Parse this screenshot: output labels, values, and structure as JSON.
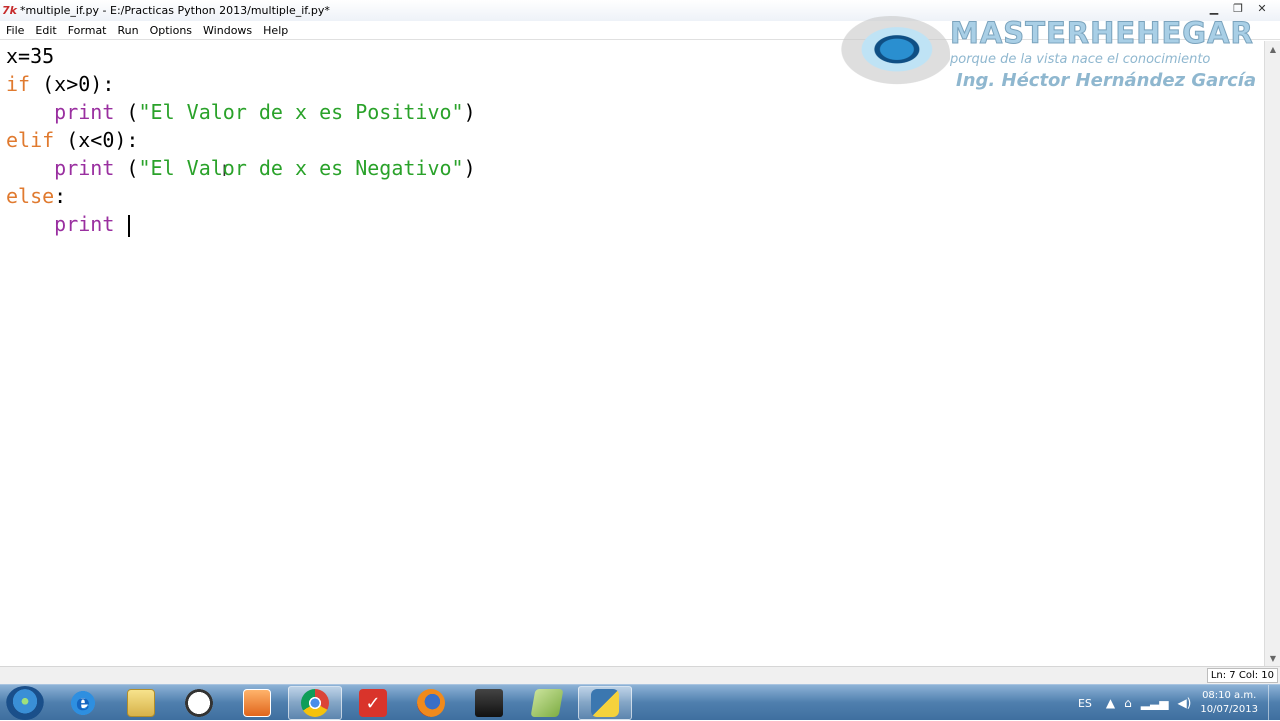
{
  "window": {
    "title": "*multiple_if.py - E:/Practicas Python 2013/multiple_if.py*",
    "controls": {
      "minimize": "▁",
      "maximize": "❐",
      "close": "✕"
    }
  },
  "menu": {
    "items": [
      "File",
      "Edit",
      "Format",
      "Run",
      "Options",
      "Windows",
      "Help"
    ]
  },
  "editor": {
    "lines": [
      {
        "parts": [
          {
            "text": "x=35",
            "kind": "plain"
          }
        ]
      },
      {
        "parts": [
          {
            "text": "if",
            "kind": "kw"
          },
          {
            "text": " (x>0):",
            "kind": "plain"
          }
        ]
      },
      {
        "parts": [
          {
            "text": "    ",
            "kind": "plain"
          },
          {
            "text": "print",
            "kind": "bi"
          },
          {
            "text": " (",
            "kind": "plain"
          },
          {
            "text": "\"El Valor de x es Positivo\"",
            "kind": "str"
          },
          {
            "text": ")",
            "kind": "plain"
          }
        ]
      },
      {
        "parts": [
          {
            "text": "elif",
            "kind": "kw"
          },
          {
            "text": " (x<0):",
            "kind": "plain"
          }
        ]
      },
      {
        "parts": [
          {
            "text": "    ",
            "kind": "plain"
          },
          {
            "text": "print",
            "kind": "bi"
          },
          {
            "text": " (",
            "kind": "plain"
          },
          {
            "text": "\"El Valor de x es Negativo\"",
            "kind": "str"
          },
          {
            "text": ")",
            "kind": "plain"
          }
        ]
      },
      {
        "parts": [
          {
            "text": "else",
            "kind": "kw"
          },
          {
            "text": ":",
            "kind": "plain"
          }
        ]
      },
      {
        "parts": [
          {
            "text": "    ",
            "kind": "plain"
          },
          {
            "text": "print",
            "kind": "bi"
          },
          {
            "text": " ",
            "kind": "plain"
          }
        ],
        "caret": true
      }
    ],
    "colors": {
      "keyword": "#e07a2f",
      "builtin": "#9a2fa0",
      "string": "#2aa22a",
      "plain": "#000000"
    }
  },
  "watermark": {
    "title": "MASTERHEHEGAR",
    "subtitle": "porque de la vista nace el conocimiento",
    "author": "Ing. Héctor Hernández García"
  },
  "status": {
    "position": "Ln: 7 Col: 10"
  },
  "taskbar": {
    "apps": [
      "internet-explorer",
      "file-explorer",
      "clock-app",
      "media-player",
      "chrome",
      "todo-app",
      "firefox",
      "camera-app",
      "notes-app",
      "python-idle"
    ],
    "active_app": "chrome",
    "language": "ES",
    "time": "08:10 a.m.",
    "date": "10/07/2013"
  }
}
